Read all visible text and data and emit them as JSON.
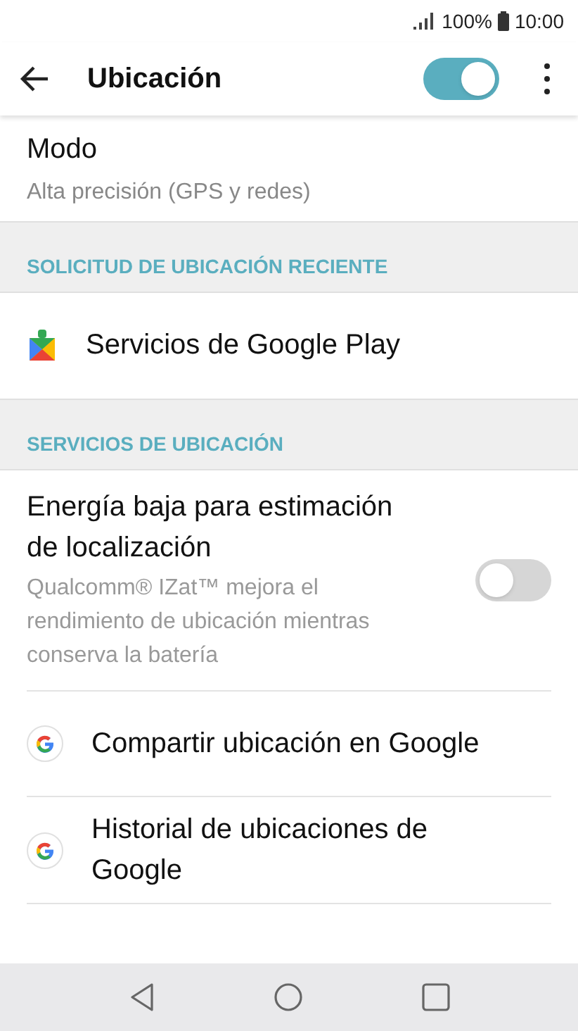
{
  "status_bar": {
    "battery": "100%",
    "time": "10:00"
  },
  "app_bar": {
    "title": "Ubicación",
    "location_on": true
  },
  "mode": {
    "title": "Modo",
    "summary": "Alta precisión (GPS y redes)"
  },
  "sections": [
    {
      "header": "SOLICITUD DE UBICACIÓN RECIENTE",
      "items": [
        {
          "kind": "play_app",
          "title": "Servicios de Google Play"
        }
      ]
    },
    {
      "header": "SERVICIOS DE UBICACIÓN",
      "items": [
        {
          "kind": "toggle",
          "title": "Energía baja para estimación de localización",
          "summary": "Qualcomm® IZat™ mejora el rendimiento de ubicación mientras conserva la batería",
          "on": false
        },
        {
          "kind": "google_app",
          "title": "Compartir ubicación en Google"
        },
        {
          "kind": "google_app",
          "title": "Historial de ubicaciones de Google"
        }
      ]
    }
  ]
}
